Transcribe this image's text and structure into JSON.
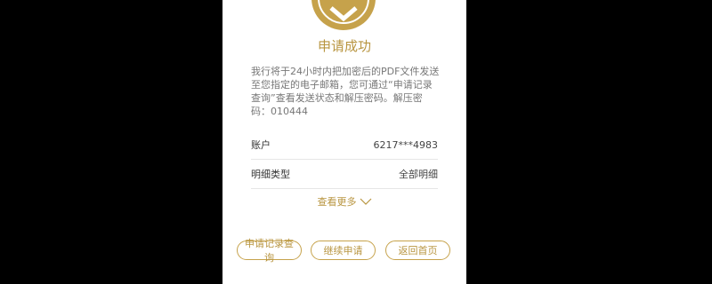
{
  "result": {
    "title": "申请成功",
    "message": "我行将于24小时内把加密后的PDF文件发送至您指定的电子邮箱，您可通过“申请记录查询”查看发送状态和解压密码。解压密码：010444"
  },
  "details": [
    {
      "label": "账户",
      "value": "6217***4983"
    },
    {
      "label": "明细类型",
      "value": "全部明细"
    }
  ],
  "more_label": "查看更多",
  "buttons": {
    "records": "申请记录查询",
    "continue": "继续申请",
    "home": "返回首页"
  },
  "colors": {
    "accent": "#c6a24b",
    "background": "#000000",
    "panel": "#ffffff"
  },
  "icons": {
    "success": "checkmark-icon",
    "more": "chevron-down-icon"
  }
}
